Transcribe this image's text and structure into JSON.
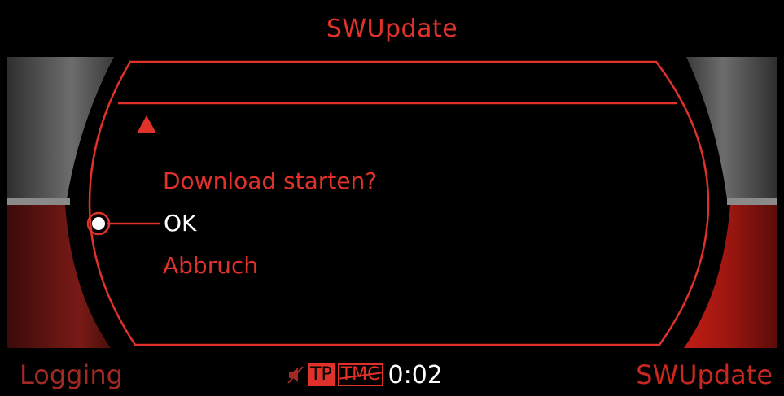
{
  "header": {
    "title": "SWUpdate"
  },
  "dialog": {
    "prompt": "Download starten?",
    "options": [
      {
        "label": "OK",
        "selected": true
      },
      {
        "label": "Abbruch",
        "selected": false
      }
    ]
  },
  "footer": {
    "left_label": "Logging",
    "right_label": "SWUpdate",
    "status": {
      "tp": "TP",
      "tmc": "TMC",
      "time": "0:02"
    }
  },
  "icons": [
    "scroll-up-arrow-icon",
    "selection-dot-icon",
    "mute-icon"
  ],
  "colors": {
    "accent": "#e0322a",
    "highlight": "#ffffff",
    "background": "#000000"
  }
}
